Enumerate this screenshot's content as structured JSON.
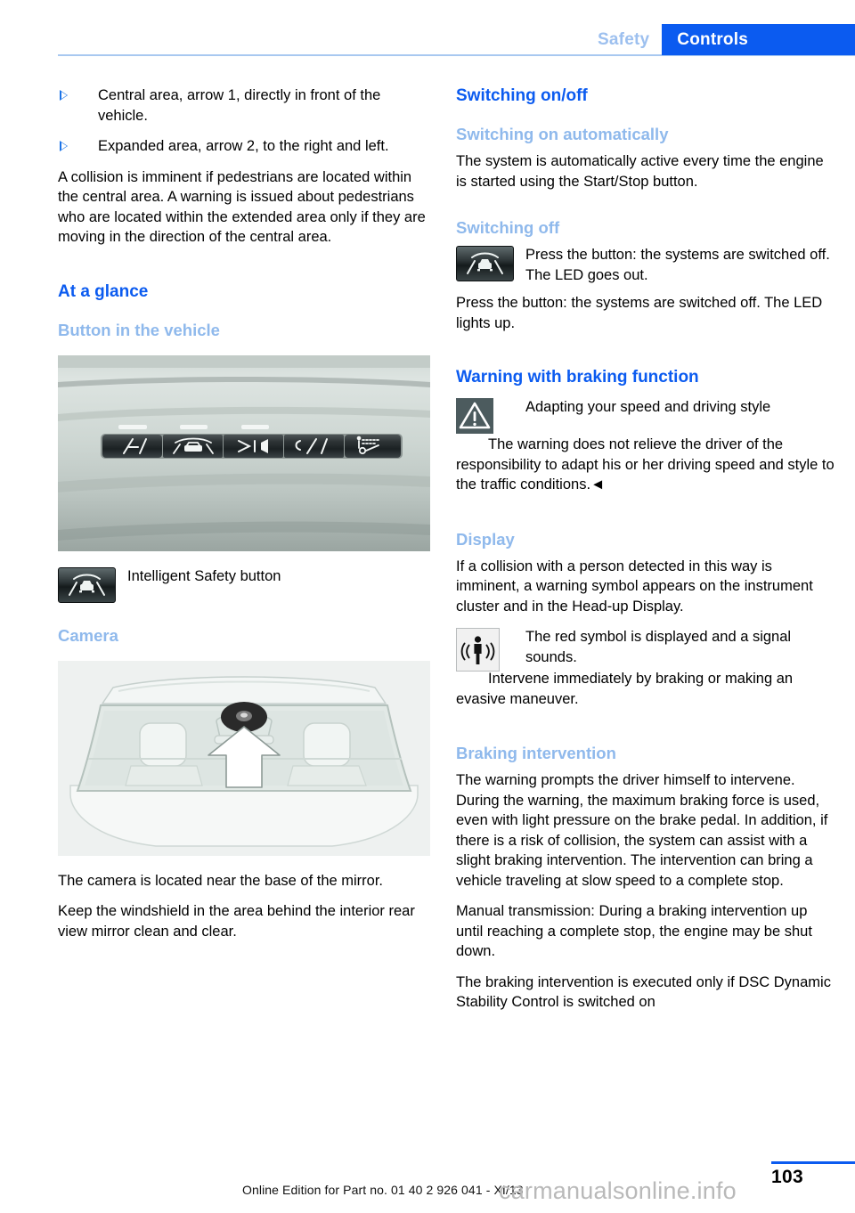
{
  "header": {
    "tab_inactive": "Safety",
    "tab_active": "Controls",
    "accent_blue": "#0b5bf0",
    "light_blue": "#8fb9ec"
  },
  "left_column": {
    "bullets": [
      "Central area, arrow 1, directly in front of the vehicle.",
      "Expanded area, arrow 2, to the right and left."
    ],
    "paragraph_1": "A collision is imminent if pedestrians are located within the central area. A warning is issued about pedestrians who are located within the extended area only if they are moving in the direction of the central area.",
    "heading_at_a_glance": "At a glance",
    "heading_button_in_vehicle": "Button in the vehicle",
    "button_figure_caption": "Intelligent Safety button",
    "heading_camera": "Camera",
    "paragraph_camera_1": "The camera is located near the base of the mirror.",
    "paragraph_camera_2": "Keep the windshield in the area behind the interior rear view mirror clean and clear."
  },
  "right_column": {
    "heading_switching_onoff": "Switching on/off",
    "heading_switching_on_auto": "Switching on automatically",
    "paragraph_switching_on_auto": "The system is automatically active every time the engine is started using the Start/Stop button.",
    "heading_switching_off": "Switching off",
    "switching_off_icon_text": "Press the button: the systems are switched off. The LED goes out.",
    "paragraph_switching_off": "Press the button: the systems are switched off. The LED lights up.",
    "heading_warning_braking": "Warning with braking function",
    "warning_title": "Adapting your speed and driving style",
    "warning_body": "The warning does not relieve the driver of the responsibility to adapt his or her driving speed and style to the traffic conditions.◄",
    "heading_display": "Display",
    "paragraph_display": "If a collision with a person detected in this way is imminent, a warning symbol appears on the instrument cluster and in the Head-up Display.",
    "display_icon_text": "The red symbol is displayed and a signal sounds.",
    "display_followup": "Intervene immediately by braking or making an evasive maneuver.",
    "heading_braking_intervention": "Braking intervention",
    "paragraph_braking_1": "The warning prompts the driver himself to intervene. During the warning, the maximum braking force is used, even with light pressure on the brake pedal. In addition, if there is a risk of collision, the system can assist with a slight braking intervention. The intervention can bring a vehicle traveling at slow speed to a complete stop.",
    "paragraph_braking_2": "Manual transmission: During a braking intervention up until reaching a complete stop, the engine may be shut down.",
    "paragraph_braking_3": "The braking intervention is executed only if DSC Dynamic Stability Control is switched on"
  },
  "footer": {
    "edition": "Online Edition for Part no. 01 40 2 926 041 - XI/13",
    "watermark": "carmanualsonline.info",
    "page_number": "103"
  }
}
